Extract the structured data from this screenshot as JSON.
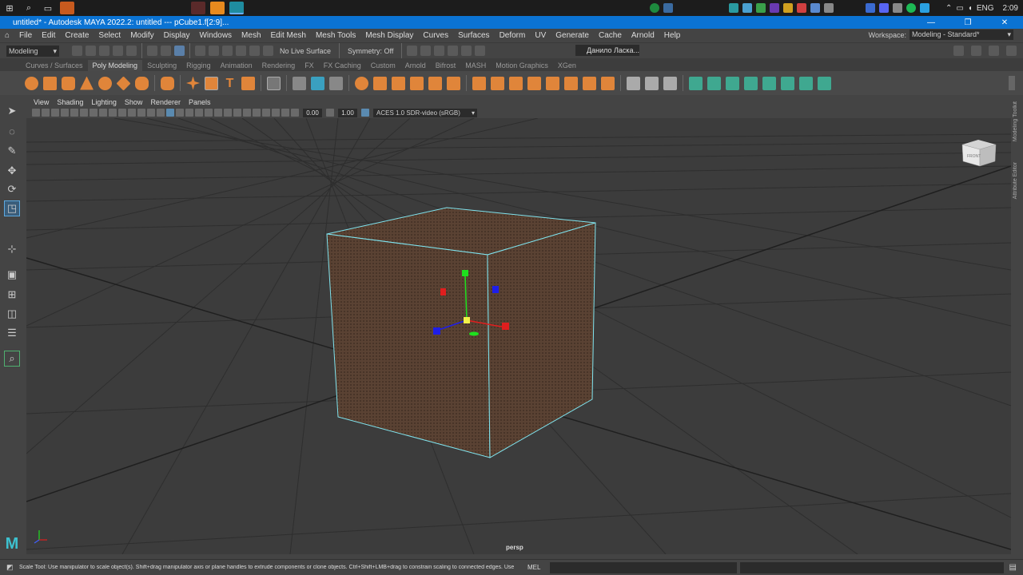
{
  "taskbar": {
    "tray_lang": "ENG",
    "clock": "2:09"
  },
  "window": {
    "title": "untitled* - Autodesk MAYA 2022.2: untitled   ---   pCube1.f[2:9]...",
    "minimize": "—",
    "maximize": "❐",
    "close": "✕"
  },
  "menus": [
    "File",
    "Edit",
    "Create",
    "Select",
    "Modify",
    "Display",
    "Windows",
    "Mesh",
    "Edit Mesh",
    "Mesh Tools",
    "Mesh Display",
    "Curves",
    "Surfaces",
    "Deform",
    "UV",
    "Generate",
    "Cache",
    "Arnold",
    "Help"
  ],
  "workspace": {
    "label": "Workspace:",
    "value": "Modeling - Standard*"
  },
  "statusline": {
    "mode": "Modeling",
    "live_surface": "No Live Surface",
    "symmetry": "Symmetry: Off",
    "user": "Данило Ласка..."
  },
  "shelf_tabs": [
    "Curves / Surfaces",
    "Poly Modeling",
    "Sculpting",
    "Rigging",
    "Animation",
    "Rendering",
    "FX",
    "FX Caching",
    "Custom",
    "Arnold",
    "Bifrost",
    "MASH",
    "Motion Graphics",
    "XGen"
  ],
  "viewport": {
    "menus": [
      "View",
      "Shading",
      "Lighting",
      "Show",
      "Renderer",
      "Panels"
    ],
    "exposure": "0.00",
    "gamma": "1.00",
    "color_space": "ACES 1.0 SDR-video (sRGB)",
    "camera": "persp",
    "viewcube_face": "FRONT"
  },
  "side_panel": {
    "tab1": "Modeling Toolkit",
    "tab2": "Attribute Editor"
  },
  "helpline": {
    "text": "Scale Tool: Use manipulator to scale object(s). Shift+drag manipulator axis or plane handles to extrude components or clone objects. Ctrl+Shift+LMB+drag to constrain scaling to connected edges. Use D or INSE",
    "mel": "MEL"
  },
  "colors": {
    "title_blue": "#0b73d3",
    "cube_face": "#5a4233",
    "selection_wire": "#7fe3ee",
    "axis_x": "#e01e1e",
    "axis_y": "#1ee01e",
    "axis_z": "#1e1ee8",
    "center": "#f2f24a"
  }
}
